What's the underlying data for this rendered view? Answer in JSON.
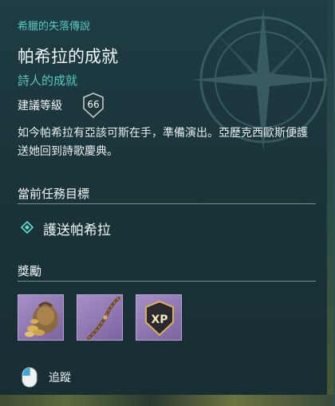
{
  "quest": {
    "category": "希臘的失落傳說",
    "title": "帕希拉的成就",
    "subtitle": "詩人的成就",
    "level_label": "建議等級",
    "level_value": "66",
    "description": "如今帕希拉有亞該可斯在手，準備演出。亞歷克西歐斯便護送她回到詩歌慶典。"
  },
  "objectives": {
    "header": "當前任務目標",
    "items": [
      {
        "text": "護送帕希拉",
        "icon": "diamond-objective-icon"
      }
    ]
  },
  "rewards": {
    "header": "獎勵",
    "items": [
      {
        "name": "coin-pouch-icon"
      },
      {
        "name": "bow-icon"
      },
      {
        "name": "xp-shield-icon",
        "badge": "XP"
      }
    ]
  },
  "tracking": {
    "label": "追蹤",
    "icon": "mouse-icon"
  },
  "colors": {
    "accent": "#57c8c4",
    "reward_tile": "#957db8"
  }
}
